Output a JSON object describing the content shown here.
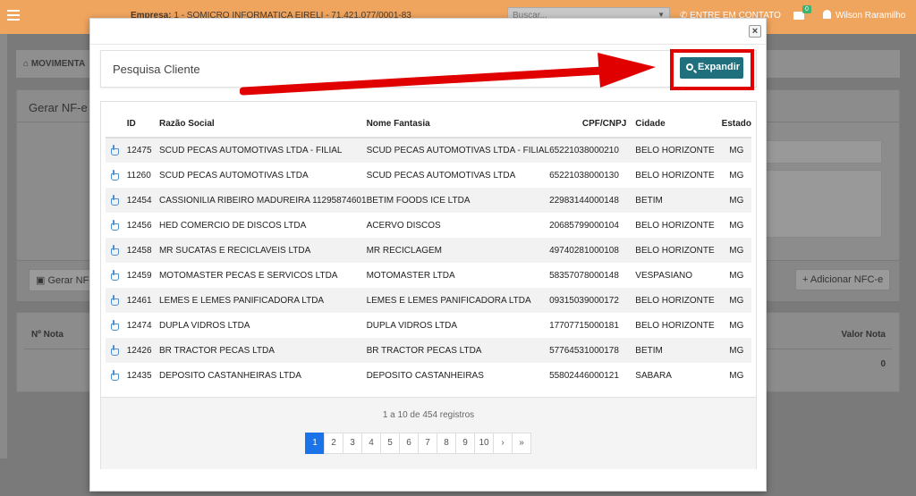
{
  "topbar": {
    "company_label": "Empresa:",
    "company_value": "1 - SOMICRO INFORMATICA EIRELI - 71.421.077/0001-83",
    "search_placeholder": "Buscar...",
    "contact_label": "ENTRE EM CONTATO",
    "mail_count": "0",
    "user_name": "Wilson Raramilho"
  },
  "background": {
    "breadcrumb": "MOVIMENTA",
    "panel_title": "Gerar NF-e a",
    "generate_button": "Gerar NF-e",
    "add_button": "Adicionar NFC-e",
    "col_nota": "Nº Nota",
    "col_valor": "Valor Nota",
    "valor_zero": "0"
  },
  "modal": {
    "title": "Pesquisa Cliente",
    "close_label": "×",
    "expand_button": "Expandir",
    "columns": {
      "id": "ID",
      "razao": "Razão Social",
      "fantasia": "Nome Fantasia",
      "cpf": "CPF/CNPJ",
      "cidade": "Cidade",
      "estado": "Estado"
    },
    "rows": [
      {
        "id": "12475",
        "razao": "SCUD PECAS AUTOMOTIVAS LTDA - FILIAL",
        "fantasia": "SCUD PECAS AUTOMOTIVAS LTDA - FILIAL",
        "cpf": "65221038000210",
        "cidade": "BELO HORIZONTE",
        "estado": "MG"
      },
      {
        "id": "11260",
        "razao": "SCUD PECAS AUTOMOTIVAS LTDA",
        "fantasia": "SCUD PECAS AUTOMOTIVAS LTDA",
        "cpf": "65221038000130",
        "cidade": "BELO HORIZONTE",
        "estado": "MG"
      },
      {
        "id": "12454",
        "razao": "CASSIONILIA RIBEIRO MADUREIRA 11295874601",
        "fantasia": "BETIM FOODS ICE LTDA",
        "cpf": "22983144000148",
        "cidade": "BETIM",
        "estado": "MG"
      },
      {
        "id": "12456",
        "razao": "HED COMERCIO DE DISCOS LTDA",
        "fantasia": "ACERVO DISCOS",
        "cpf": "20685799000104",
        "cidade": "BELO HORIZONTE",
        "estado": "MG"
      },
      {
        "id": "12458",
        "razao": "MR SUCATAS E RECICLAVEIS LTDA",
        "fantasia": "MR RECICLAGEM",
        "cpf": "49740281000108",
        "cidade": "BELO HORIZONTE",
        "estado": "MG"
      },
      {
        "id": "12459",
        "razao": "MOTOMASTER PECAS E SERVICOS LTDA",
        "fantasia": "MOTOMASTER LTDA",
        "cpf": "58357078000148",
        "cidade": "VESPASIANO",
        "estado": "MG"
      },
      {
        "id": "12461",
        "razao": "LEMES E LEMES PANIFICADORA LTDA",
        "fantasia": "LEMES E LEMES PANIFICADORA LTDA",
        "cpf": "09315039000172",
        "cidade": "BELO HORIZONTE",
        "estado": "MG"
      },
      {
        "id": "12474",
        "razao": "DUPLA VIDROS LTDA",
        "fantasia": "DUPLA VIDROS LTDA",
        "cpf": "17707715000181",
        "cidade": "BELO HORIZONTE",
        "estado": "MG"
      },
      {
        "id": "12426",
        "razao": "BR TRACTOR PECAS LTDA",
        "fantasia": "BR TRACTOR PECAS LTDA",
        "cpf": "57764531000178",
        "cidade": "BETIM",
        "estado": "MG"
      },
      {
        "id": "12435",
        "razao": "DEPOSITO CASTANHEIRAS LTDA",
        "fantasia": "DEPOSITO CASTANHEIRAS",
        "cpf": "55802446000121",
        "cidade": "SABARA",
        "estado": "MG"
      }
    ],
    "records_info": "1 a 10 de 454 registros",
    "pages": [
      "1",
      "2",
      "3",
      "4",
      "5",
      "6",
      "7",
      "8",
      "9",
      "10",
      "›",
      "»"
    ],
    "active_page": "1"
  },
  "colors": {
    "topbar": "#f0a55f",
    "expand_button": "#1f6f7d",
    "annotation_red": "#e00000",
    "active_page": "#1a73e8"
  }
}
